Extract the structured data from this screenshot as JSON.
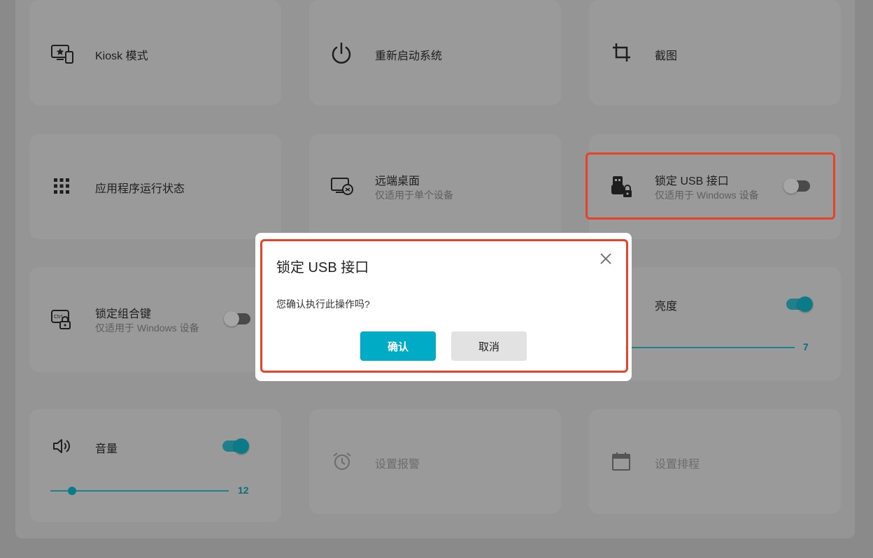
{
  "cards": {
    "kiosk": {
      "title": "Kiosk 模式",
      "icon": "kiosk-monitor-star-icon"
    },
    "restart": {
      "title": "重新启动系统",
      "icon": "power-icon"
    },
    "screenshot": {
      "title": "截图",
      "icon": "crop-icon"
    },
    "app_status": {
      "title": "应用程序运行状态",
      "icon": "grid-apps-icon"
    },
    "remote_desktop": {
      "title": "远端桌面",
      "subtitle": "仅适用于单个设备",
      "icon": "remote-desktop-icon"
    },
    "lock_usb": {
      "title": "锁定 USB 接口",
      "subtitle": "仅适用于 Windows 设备",
      "icon": "usb-lock-icon",
      "toggle_on": false
    },
    "lock_keys": {
      "title": "锁定组合键",
      "subtitle": "仅适用于 Windows 设备",
      "icon": "keyboard-lock-icon",
      "toggle_on": false
    },
    "brightness": {
      "title": "亮度",
      "toggle_on": true,
      "value": "7"
    },
    "volume": {
      "title": "音量",
      "icon": "speaker-icon",
      "toggle_on": true,
      "value": "12"
    },
    "alarm": {
      "title": "设置报警",
      "icon": "alarm-clock-icon"
    },
    "schedule": {
      "title": "设置排程",
      "icon": "calendar-icon"
    }
  },
  "dialog": {
    "title": "锁定 USB 接口",
    "message": "您确认执行此操作吗?",
    "confirm_label": "确认",
    "cancel_label": "取消",
    "close_icon": "close-icon"
  },
  "colors": {
    "accent": "#00acc5",
    "toggle_on": "#0b7c87",
    "highlight": "#e5442a",
    "overlay_bg": "#8a8a8a"
  }
}
